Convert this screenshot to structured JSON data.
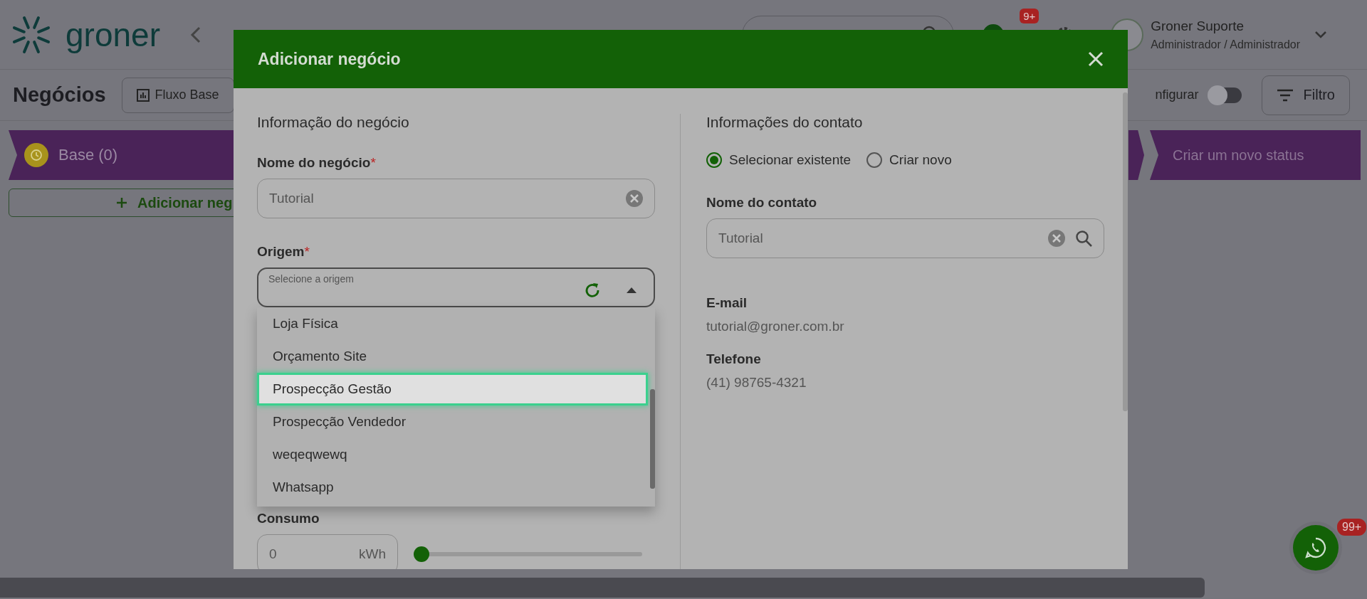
{
  "header": {
    "logo": "groner",
    "notifications_badge": "9+",
    "user_name": "Groner Suporte",
    "user_role": "Administrador / Administrador"
  },
  "toolbar": {
    "title": "Negócios",
    "flow_button": "Fluxo Base",
    "configure_label": "nfigurar",
    "configure_toggle": {
      "on": false
    },
    "filter_button": "Filtro"
  },
  "board": {
    "columns": [
      {
        "title": "Base (0)",
        "add_button": "Adicionar neg"
      }
    ],
    "new_status": "Criar um novo status"
  },
  "modal": {
    "title": "Adicionar negócio",
    "business": {
      "heading": "Informação do negócio",
      "name_field": {
        "label": "Nome do negócio",
        "required_mark": "*",
        "value": "Tutorial"
      },
      "origin_field": {
        "label": "Origem",
        "required_mark": "*",
        "placeholder": "Selecione a origem",
        "expanded": true,
        "options": [
          {
            "label": "Loja Física",
            "selected": false
          },
          {
            "label": "Orçamento Site",
            "selected": false
          },
          {
            "label": "Prospecção Gestão",
            "selected": true
          },
          {
            "label": "Prospecção Vendedor",
            "selected": false
          },
          {
            "label": "weqeqwewq",
            "selected": false
          },
          {
            "label": "Whatsapp",
            "selected": false
          }
        ]
      },
      "consumption": {
        "label": "Consumo",
        "value": "0",
        "unit": "kWh",
        "level": 0
      }
    },
    "contact": {
      "heading": "Informações do contato",
      "mode_options": [
        {
          "label": "Selecionar existente",
          "selected": true
        },
        {
          "label": "Criar novo",
          "selected": false
        }
      ],
      "name_field": {
        "label": "Nome do contato",
        "value": "Tutorial"
      },
      "email_label": "E-mail",
      "email": "tutorial@groner.com.br",
      "phone_label": "Telefone",
      "phone": "(41) 98765-4321"
    }
  },
  "chat_badge": "99+"
}
